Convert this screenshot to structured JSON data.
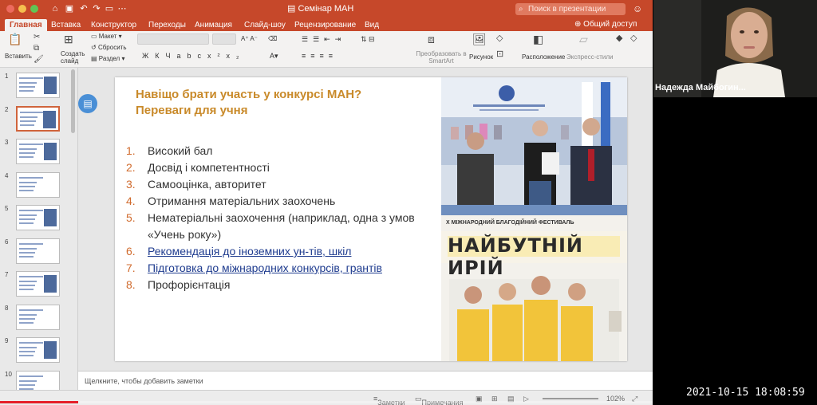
{
  "window": {
    "title": "Семінар МАН",
    "search_placeholder": "Поиск в презентации",
    "share_label": "Общий доступ"
  },
  "tabs": [
    "Главная",
    "Вставка",
    "Конструктор",
    "Переходы",
    "Анимация",
    "Слайд-шоу",
    "Рецензирование",
    "Вид"
  ],
  "ribbon": {
    "paste": "Вставить",
    "new_slide": "Создать слайд",
    "layout": "Макет",
    "reset": "Сбросить",
    "section": "Раздел",
    "smartart": "Преобразовать в SmartArt",
    "picture": "Рисунок",
    "arrange": "Расположение",
    "quick_styles": "Экспресс-стили"
  },
  "thumbnail_numbers": [
    "1",
    "2",
    "3",
    "4",
    "5",
    "6",
    "7",
    "8",
    "9",
    "10"
  ],
  "selected_thumbnail": 2,
  "slide": {
    "title_line1": "Навіщо брати участь у конкурсі МАН?",
    "title_line2": "Переваги для учня",
    "items": [
      {
        "num": "1.",
        "text": "Високий бал",
        "link": false
      },
      {
        "num": "2.",
        "text": "Досвід і компетентності",
        "link": false
      },
      {
        "num": "3.",
        "text": "Самооцінка, авторитет",
        "link": false
      },
      {
        "num": "4.",
        "text": "Отримання матеріальних заохочень",
        "link": false
      },
      {
        "num": "5.",
        "text": "Нематеріальні заохочення (наприклад, одна з умов «Учень року»)",
        "link": false
      },
      {
        "num": "6.",
        "text": "Рекомендація до іноземних ун-тів, шкіл",
        "link": true
      },
      {
        "num": "7.",
        "text": "Підготовка до міжнародних конкурсів, грантів",
        "link": true
      },
      {
        "num": "8.",
        "text": "Профорієнтація",
        "link": false
      }
    ],
    "festival_top": "X МІЖНАРОДНИЙ БЛАГОДІЙНИЙ ФЕСТИВАЛЬ",
    "festival_name": "НАЙБУТНІЙ ИРІЙ"
  },
  "notes_placeholder": "Щелкните, чтобы добавить заметки",
  "status": {
    "notes": "Заметки",
    "comments": "Примечания",
    "zoom": "102%"
  },
  "progress": 0.12,
  "webcam": {
    "participant_name": "Надежда Майбогин..."
  },
  "timestamp": "2021-10-15 18:08:59",
  "colors": {
    "ppt_accent": "#c6482a",
    "title_color": "#c98a2a",
    "number_color": "#d06a2c",
    "link_color": "#1f3c8f"
  }
}
